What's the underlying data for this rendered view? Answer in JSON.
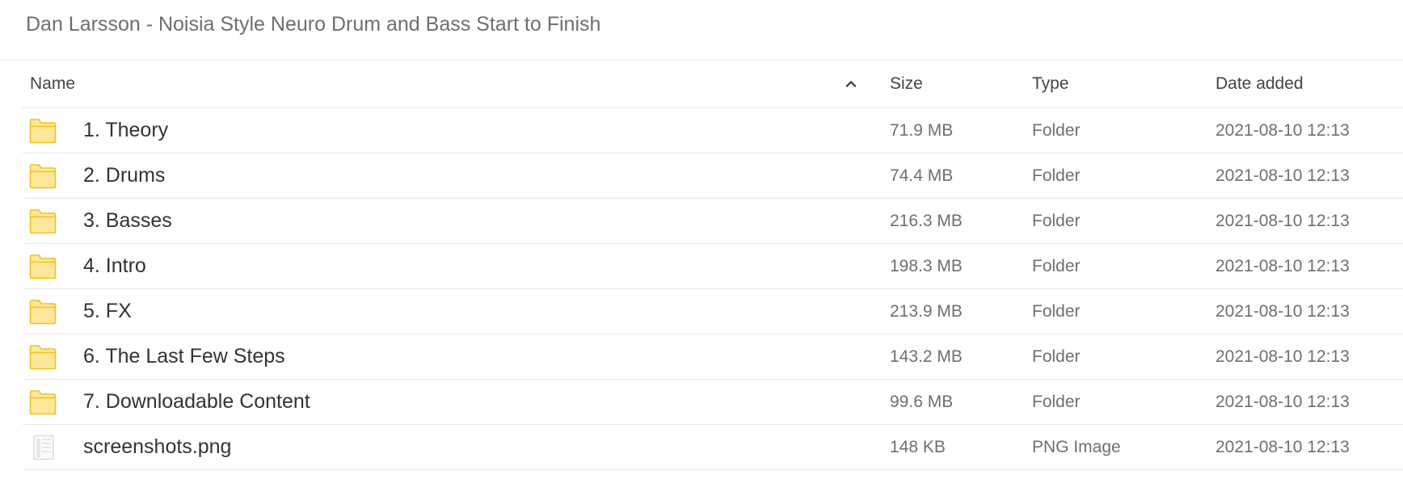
{
  "page": {
    "title": "Dan Larsson - Noisia Style Neuro Drum and Bass Start to Finish"
  },
  "columns": {
    "name": "Name",
    "size": "Size",
    "type": "Type",
    "date": "Date added",
    "sort_icon": "chevron-up-icon"
  },
  "colors": {
    "folder_fill": "#fde79a",
    "folder_stroke": "#f2c01e",
    "divider": "#e8e8e8"
  },
  "rows": [
    {
      "icon": "folder-icon",
      "name": "1. Theory",
      "size": "71.9 MB",
      "type": "Folder",
      "date": "2021-08-10 12:13"
    },
    {
      "icon": "folder-icon",
      "name": "2. Drums",
      "size": "74.4 MB",
      "type": "Folder",
      "date": "2021-08-10 12:13"
    },
    {
      "icon": "folder-icon",
      "name": "3. Basses",
      "size": "216.3 MB",
      "type": "Folder",
      "date": "2021-08-10 12:13"
    },
    {
      "icon": "folder-icon",
      "name": "4. Intro",
      "size": "198.3 MB",
      "type": "Folder",
      "date": "2021-08-10 12:13"
    },
    {
      "icon": "folder-icon",
      "name": "5. FX",
      "size": "213.9 MB",
      "type": "Folder",
      "date": "2021-08-10 12:13"
    },
    {
      "icon": "folder-icon",
      "name": "6. The Last Few Steps",
      "size": "143.2 MB",
      "type": "Folder",
      "date": "2021-08-10 12:13"
    },
    {
      "icon": "folder-icon",
      "name": "7. Downloadable Content",
      "size": "99.6 MB",
      "type": "Folder",
      "date": "2021-08-10 12:13"
    },
    {
      "icon": "image-file-icon",
      "name": "screenshots.png",
      "size": "148 KB",
      "type": "PNG Image",
      "date": "2021-08-10 12:13"
    }
  ]
}
